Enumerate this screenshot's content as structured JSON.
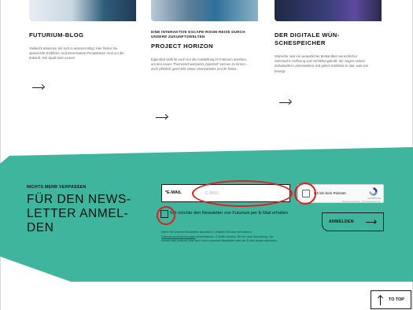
{
  "cards": [
    {
      "kicker": "",
      "title": "FUTURIUM-BLOG",
      "text": "Vielleicht erkennen Sie sich in unserem Blog: Hier finden Sie spannende Einblicke, und interessante Perspektiven rund um die Zukunft. Viel Spaß beim Lesen!",
      "link_icon": "arrow-right-icon"
    },
    {
      "kicker": "EINE INTERAKTIVE ESCAPE-ROOM-REISE DURCH UNSERE ZUKUNFTSWELTEN",
      "title": "PROJECT HORIZON",
      "text": "Eigentlich wollt ihr euch nur die Ausstellung im Futurium ansehen, um den neuen Themenschwerpunkt „Spielzeit“ kennen zu lernen... doch plötzlich geschieht etwas Unerwartetes und ihr findet...",
      "link_icon": "arrow-right-icon"
    },
    {
      "kicker": "",
      "title": "DER DIGITALE WÜN-SCHESPEICHER",
      "text": "Wünsche sind ein wesentlicher Bestandteil menschlicher Sehnsucht, Hoffnung und Vorstellungskraft. Sie zeigen unsere individuellen Lebenswelten und geben Einblicke in das, was uns bewegt.",
      "link_icon": "arrow-right-icon"
    }
  ],
  "newsletter": {
    "kicker": "NICHTS MEHR VERPASSEN",
    "heading": "FÜR DEN NEWS-LETTER ANMEL-DEN",
    "email_label": "E-MAIL",
    "required_mark": "*",
    "email_placeholder": "E-MAIL",
    "email_value": "",
    "recaptcha": {
      "label": "Ich bin kein Roboter.",
      "brand": "reCAPTCHA",
      "terms": "Datenschutzerklärung · Nutzungsbedingungen"
    },
    "consent_text": "Ich möchte den Newsletter von Futurium per E-Mail erhalten",
    "disclaimer_before": "Wenn Sie unseren Newsletter abonnieren, erklären Sie sich mit unseren ",
    "disclaimer_link": "Datenschutzbestimmungen",
    "disclaimer_after": " einverstanden. E-Mails erhalten Sie nur nach Abmeldung. Sie können sich jederzeit über den Link in unserem Newsletter oder per E-Mail wieder abmelden.",
    "submit_label": "ANMELDEN"
  },
  "to_top": {
    "label": "TO TOP"
  },
  "colors": {
    "band": "#3eb59c",
    "annotation": "#e01e1e",
    "text": "#111111"
  }
}
